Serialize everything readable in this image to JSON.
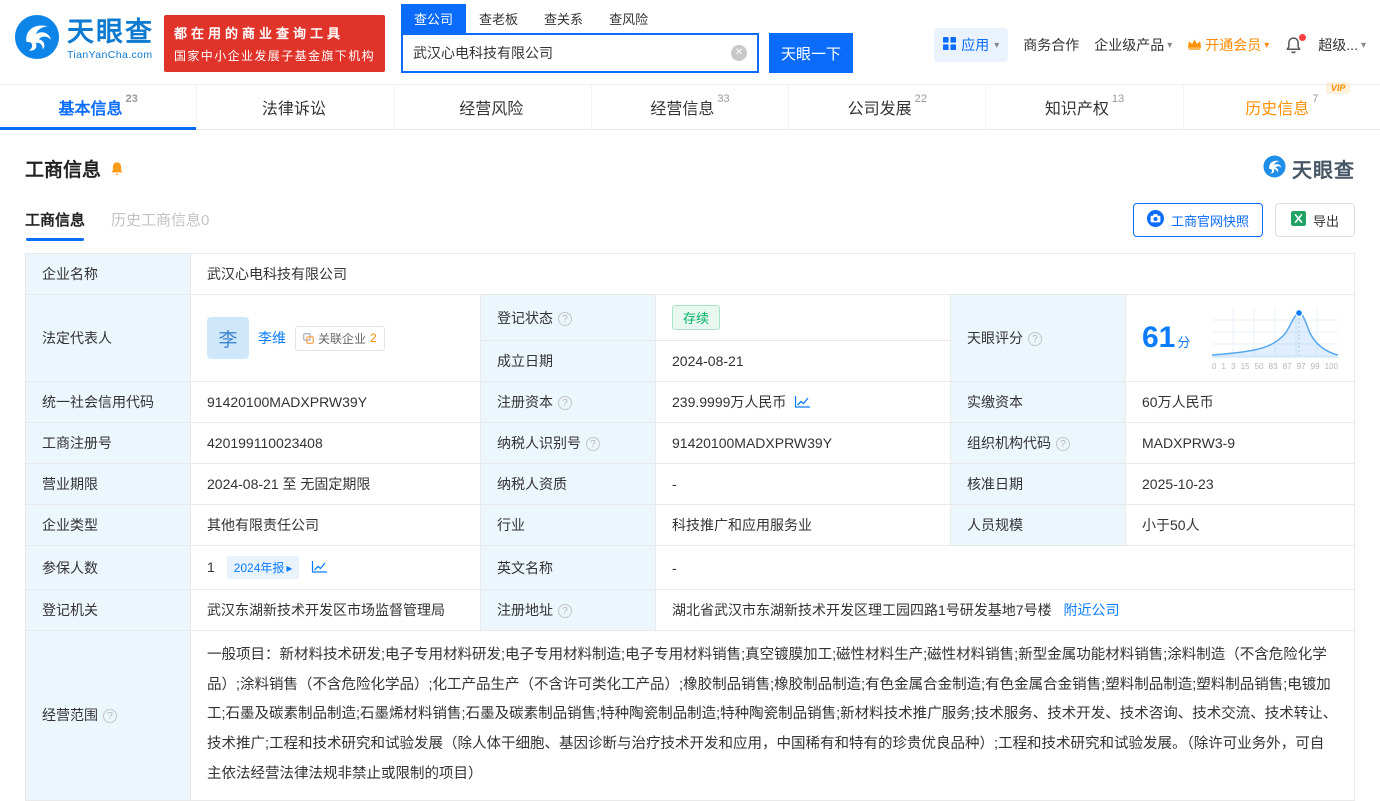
{
  "brand": {
    "name": "天眼查",
    "domain": "TianYanCha.com",
    "promo_line1": "都在用的商业查询工具",
    "promo_line2": "国家中小企业发展子基金旗下机构"
  },
  "icons": {
    "help": "?",
    "caret_down": "▾",
    "caret_right": "▸",
    "clear": "✕",
    "vip_badge": "VIP"
  },
  "search": {
    "tabs": [
      {
        "label": "查公司"
      },
      {
        "label": "查老板"
      },
      {
        "label": "查关系"
      },
      {
        "label": "查风险"
      }
    ],
    "value": "武汉心电科技有限公司",
    "button": "天眼一下"
  },
  "top_nav": {
    "app": "应用",
    "cooperation": "商务合作",
    "enterprise": "企业级产品",
    "membership": "开通会员",
    "user": "超级..."
  },
  "main_tabs": [
    {
      "label": "基本信息",
      "count": "23"
    },
    {
      "label": "法律诉讼",
      "count": ""
    },
    {
      "label": "经营风险",
      "count": ""
    },
    {
      "label": "经营信息",
      "count": "33"
    },
    {
      "label": "公司发展",
      "count": "22"
    },
    {
      "label": "知识产权",
      "count": "13"
    },
    {
      "label": "历史信息",
      "count": "7"
    }
  ],
  "section": {
    "title": "工商信息",
    "subtab_active": "工商信息",
    "subtab_history": "历史工商信息",
    "subtab_history_count": "0",
    "snapshot_button": "工商官网快照",
    "export_button": "导出",
    "watermark": "天眼查"
  },
  "company": {
    "name_label": "企业名称",
    "name": "武汉心电科技有限公司",
    "legal_rep_label": "法定代表人",
    "legal_rep_avatar": "李",
    "legal_rep_name": "李维",
    "related_label": "关联企业",
    "related_count": "2",
    "status_label": "登记状态",
    "status": "存续",
    "establish_label": "成立日期",
    "establish_date": "2024-08-21",
    "score_label": "天眼评分",
    "score": "61",
    "score_unit": "分",
    "score_axis": [
      "0",
      "1",
      "3",
      "15",
      "50",
      "83",
      "87",
      "97",
      "99",
      "100"
    ],
    "credit_code_label": "统一社会信用代码",
    "credit_code": "91420100MADXPRW39Y",
    "reg_capital_label": "注册资本",
    "reg_capital": "239.9999万人民币",
    "paid_capital_label": "实缴资本",
    "paid_capital": "60万人民币",
    "reg_no_label": "工商注册号",
    "reg_no": "420199110023408",
    "taxpayer_id_label": "纳税人识别号",
    "taxpayer_id": "91420100MADXPRW39Y",
    "org_code_label": "组织机构代码",
    "org_code": "MADXPRW3-9",
    "term_label": "营业期限",
    "term": "2024-08-21 至 无固定期限",
    "taxpayer_qual_label": "纳税人资质",
    "taxpayer_qual": "-",
    "approval_label": "核准日期",
    "approval_date": "2025-10-23",
    "type_label": "企业类型",
    "type": "其他有限责任公司",
    "industry_label": "行业",
    "industry": "科技推广和应用服务业",
    "staff_label": "人员规模",
    "staff": "小于50人",
    "insured_label": "参保人数",
    "insured": "1",
    "annual_report_badge": "2024年报",
    "english_label": "英文名称",
    "english_name": "-",
    "authority_label": "登记机关",
    "authority": "武汉东湖新技术开发区市场监督管理局",
    "address_label": "注册地址",
    "address": "湖北省武汉市东湖新技术开发区理工园四路1号研发基地7号楼",
    "nearby_link": "附近公司",
    "scope_label": "经营范围",
    "scope": "一般项目：新材料技术研发;电子专用材料研发;电子专用材料制造;电子专用材料销售;真空镀膜加工;磁性材料生产;磁性材料销售;新型金属功能材料销售;涂料制造（不含危险化学品）;涂料销售（不含危险化学品）;化工产品生产（不含许可类化工产品）;橡胶制品销售;橡胶制品制造;有色金属合金制造;有色金属合金销售;塑料制品制造;塑料制品销售;电镀加工;石墨及碳素制品制造;石墨烯材料销售;石墨及碳素制品销售;特种陶瓷制品制造;特种陶瓷制品销售;新材料技术推广服务;技术服务、技术开发、技术咨询、技术交流、技术转让、技术推广;工程和技术研究和试验发展（除人体干细胞、基因诊断与治疗技术开发和应用，中国稀有和特有的珍贵优良品种）;工程和技术研究和试验发展。（除许可业务外，可自主依法经营法律法规非禁止或限制的项目）"
  }
}
